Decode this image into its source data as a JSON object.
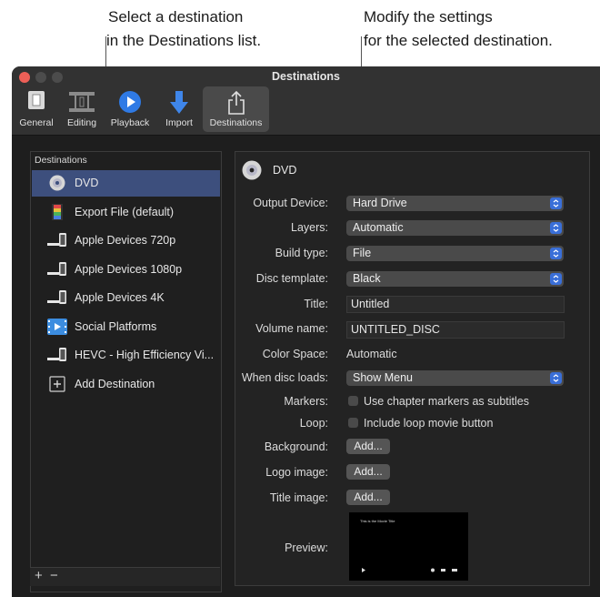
{
  "callouts": {
    "left_line1": "Select a destination",
    "left_line2": "in the Destinations list.",
    "right_line1": "Modify the settings",
    "right_line2": "for the selected destination."
  },
  "window": {
    "title": "Destinations"
  },
  "toolbar": {
    "items": [
      {
        "label": "General",
        "icon": "general-icon",
        "active": false
      },
      {
        "label": "Editing",
        "icon": "editing-icon",
        "active": false
      },
      {
        "label": "Playback",
        "icon": "playback-icon",
        "active": false
      },
      {
        "label": "Import",
        "icon": "import-icon",
        "active": false
      },
      {
        "label": "Destinations",
        "icon": "share-icon",
        "active": true
      }
    ]
  },
  "sidebar": {
    "header": "Destinations",
    "items": [
      {
        "label": "DVD",
        "icon": "disc-icon",
        "selected": true
      },
      {
        "label": "Export File (default)",
        "icon": "export-file-icon",
        "selected": false
      },
      {
        "label": "Apple Devices 720p",
        "icon": "devices-icon",
        "selected": false
      },
      {
        "label": "Apple Devices 1080p",
        "icon": "devices-icon",
        "selected": false
      },
      {
        "label": "Apple Devices 4K",
        "icon": "devices-icon",
        "selected": false
      },
      {
        "label": "Social Platforms",
        "icon": "social-platforms-icon",
        "selected": false
      },
      {
        "label": "HEVC - High Efficiency Vi...",
        "icon": "devices-icon",
        "selected": false
      },
      {
        "label": "Add Destination",
        "icon": "plus-box-icon",
        "selected": false
      }
    ],
    "add_symbol": "+",
    "remove_symbol": "−"
  },
  "detail": {
    "title": "DVD",
    "output_device": {
      "label": "Output Device:",
      "value": "Hard Drive"
    },
    "layers": {
      "label": "Layers:",
      "value": "Automatic"
    },
    "build_type": {
      "label": "Build type:",
      "value": "File"
    },
    "disc_template": {
      "label": "Disc template:",
      "value": "Black"
    },
    "title_field": {
      "label": "Title:",
      "value": "Untitled"
    },
    "volume_name": {
      "label": "Volume name:",
      "value": "UNTITLED_DISC"
    },
    "color_space": {
      "label": "Color Space:",
      "value": "Automatic"
    },
    "when_disc_loads": {
      "label": "When disc loads:",
      "value": "Show Menu"
    },
    "markers": {
      "label": "Markers:",
      "checkbox_label": "Use chapter markers as subtitles",
      "checked": false
    },
    "loop": {
      "label": "Loop:",
      "checkbox_label": "Include loop movie button",
      "checked": false
    },
    "background": {
      "label": "Background:",
      "button": "Add..."
    },
    "logo_image": {
      "label": "Logo image:",
      "button": "Add..."
    },
    "title_image": {
      "label": "Title image:",
      "button": "Add..."
    },
    "preview": {
      "label": "Preview:",
      "caption": "This is the Movie Title"
    }
  },
  "colors": {
    "accent": "#3a6fd8",
    "selection": "#3d4f7d",
    "window_bg": "#1e1e1e"
  }
}
